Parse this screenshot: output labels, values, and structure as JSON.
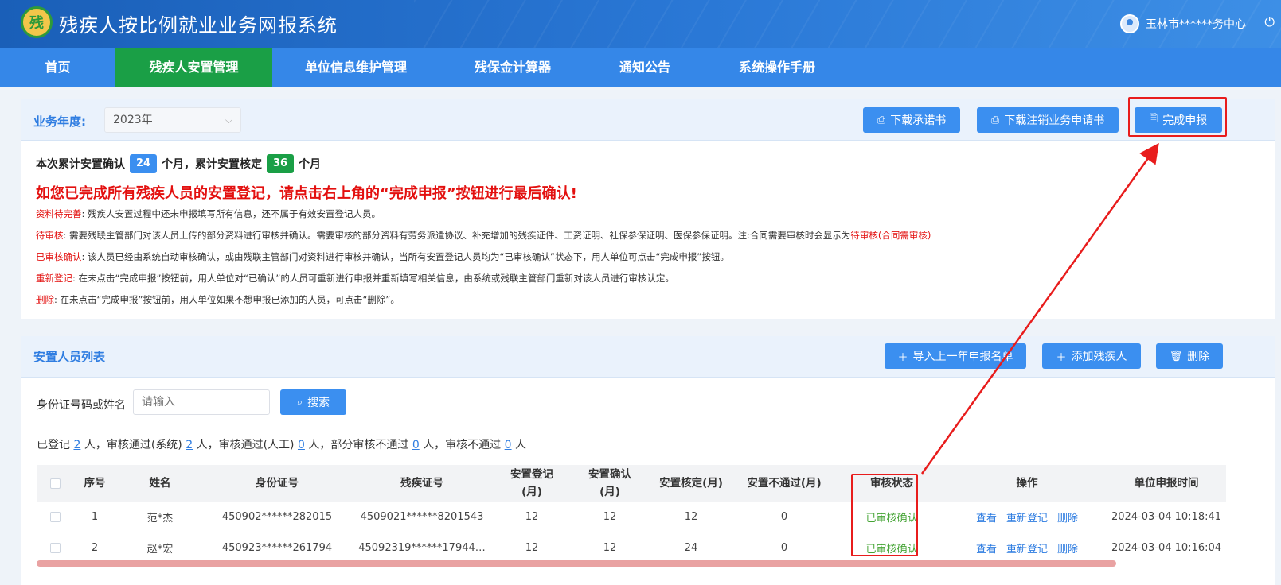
{
  "header": {
    "logo_text": "残",
    "title": "残疾人按比例就业业务网报系统",
    "user_name": "玉林市******务中心",
    "power_icon": "power-icon"
  },
  "nav": {
    "items": [
      {
        "label": "首页"
      },
      {
        "label": "残疾人安置管理"
      },
      {
        "label": "单位信息维护管理"
      },
      {
        "label": "残保金计算器"
      },
      {
        "label": "通知公告"
      },
      {
        "label": "系统操作手册"
      }
    ]
  },
  "business": {
    "year_label": "业务年度:",
    "year_value": "2023年",
    "btn_download_promise": "下载承诺书",
    "btn_download_cancel": "下载注销业务申请书",
    "btn_complete": "完成申报"
  },
  "info": {
    "summary_prefix": "本次累计安置确认",
    "confirm_months": "24",
    "summary_mid": "个月，累计安置核定",
    "verified_months": "36",
    "summary_suffix": "个月",
    "warning": "如您已完成所有残疾人员的安置登记，请点击右上角的“完成申报”按钮进行最后确认!",
    "notes": [
      {
        "tag": "资料待完善",
        "text": ": 残疾人安置过程中还未申报填写所有信息，还不属于有效安置登记人员。",
        "tail": ""
      },
      {
        "tag": "待审核",
        "text": ": 需要残联主管部门对该人员上传的部分资料进行审核并确认。需要审核的部分资料有劳务派遣协议、补充增加的残疾证件、工资证明、社保参保证明、医保参保证明。注:合同需要审核时会显示为",
        "tail": "待审核(合同需审核)"
      },
      {
        "tag": "已审核确认",
        "text": ": 该人员已经由系统自动审核确认，或由残联主管部门对资料进行审核并确认，当所有安置登记人员均为“已审核确认”状态下，用人单位可点击“完成申报”按钮。",
        "tail": ""
      },
      {
        "tag": "重新登记",
        "text": ": 在未点击“完成申报”按钮前，用人单位对“已确认”的人员可重新进行申报并重新填写相关信息，由系统或残联主管部门重新对该人员进行审核认定。",
        "tail": ""
      },
      {
        "tag": "删除",
        "text": ": 在未点击“完成申报”按钮前，用人单位如果不想申报已添加的人员，可点击“删除”。",
        "tail": ""
      }
    ]
  },
  "list": {
    "title": "安置人员列表",
    "btn_import": "导入上一年申报名单",
    "btn_add": "添加残疾人",
    "btn_delete": "删除",
    "search_label": "身份证号码或姓名",
    "search_placeholder": "请输入",
    "search_btn": "搜索",
    "stats": {
      "t1": "已登记",
      "registered": "2",
      "t2": "人，审核通过(系统)",
      "passed_system": "2",
      "t3": "人，审核通过(人工)",
      "passed_manual": "0",
      "t4": "人，部分审核不通过",
      "partial_failed": "0",
      "t5": "人，审核不通过",
      "failed": "0",
      "t6": "人"
    },
    "columns": {
      "seq": "序号",
      "name": "姓名",
      "id": "身份证号",
      "disability_id": "残疾证号",
      "reg": "安置登记\n(月)",
      "confirm": "安置确认\n(月)",
      "verify": "安置核定(月)",
      "fail": "安置不通过(月)",
      "status": "审核状态",
      "ops": "操作",
      "time": "单位申报时间"
    },
    "rows": [
      {
        "seq": "1",
        "name": "范*杰",
        "id": "450902******282015",
        "disability_id": "4509021******8201543",
        "reg": "12",
        "confirm": "12",
        "verify": "12",
        "fail": "0",
        "status": "已审核确认",
        "op_view": "查看",
        "op_rereg": "重新登记",
        "op_del": "删除",
        "time": "2024-03-04 10:18:41"
      },
      {
        "seq": "2",
        "name": "赵*宏",
        "id": "450923******261794",
        "disability_id": "45092319******17944…",
        "reg": "12",
        "confirm": "12",
        "verify": "24",
        "fail": "0",
        "status": "已审核确认",
        "op_view": "查看",
        "op_rereg": "重新登记",
        "op_del": "删除",
        "time": "2024-03-04 10:16:04"
      }
    ]
  },
  "colors": {
    "nav_bg": "#3587e8",
    "nav_active": "#1a9f46",
    "primary_btn": "#3b8ff0",
    "warning_red": "#e3100f",
    "status_green": "#45a435",
    "annotation_red": "#e81c1c"
  }
}
